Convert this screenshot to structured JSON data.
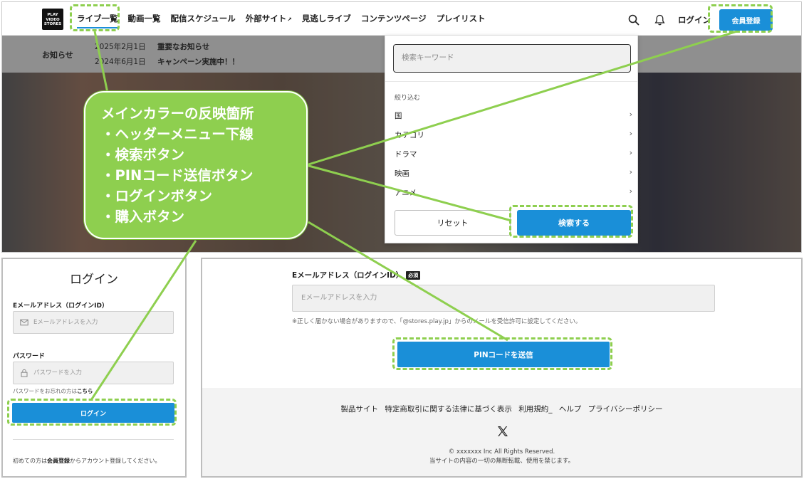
{
  "header": {
    "logo_text": "PLAY VIDEO STORES",
    "nav": [
      {
        "label": "ライブ一覧",
        "active": true
      },
      {
        "label": "動画一覧"
      },
      {
        "label": "配信スケジュール"
      },
      {
        "label": "外部サイト",
        "external": true
      },
      {
        "label": "見逃しライブ"
      },
      {
        "label": "コンテンツページ"
      },
      {
        "label": "プレイリスト"
      }
    ],
    "login_label": "ログイン",
    "register_label": "会員登録"
  },
  "notice": {
    "label": "お知らせ",
    "items": [
      {
        "date": "2025年2月1日",
        "text": "重要なお知らせ"
      },
      {
        "date": "2024年6月1日",
        "text": "キャンペーン実施中！！"
      }
    ]
  },
  "search_panel": {
    "placeholder": "検索キーワード",
    "filter_label": "絞り込む",
    "filters": [
      "国",
      "カテゴリ",
      "ドラマ",
      "映画",
      "アニメ"
    ],
    "reset_label": "リセット",
    "search_label": "検索する"
  },
  "callout": {
    "lines": [
      "メインカラーの反映箇所",
      "・ヘッダーメニュー下線",
      "・検索ボタン",
      "・PINコード送信ボタン",
      "・ログインボタン",
      "・購入ボタン"
    ]
  },
  "login_form": {
    "title": "ログイン",
    "email_label": "Eメールアドレス（ログインID）",
    "email_placeholder": "Eメールアドレスを入力",
    "password_label": "パスワード",
    "password_placeholder": "パスワードを入力",
    "forgot_prefix": "パスワードをお忘れの方は",
    "forgot_link": "こちら",
    "login_button": "ログイン",
    "first_time_prefix": "初めての方は",
    "first_time_link": "会員登録",
    "first_time_suffix": "からアカウント登録してください。"
  },
  "email_form": {
    "label": "Eメールアドレス（ログインID）",
    "required_badge": "必須",
    "placeholder": "Eメールアドレスを入力",
    "note": "※正しく届かない場合がありますので、「@stores.play.jp」からのメールを受信許可に設定してください。",
    "pin_button": "PINコードを送信"
  },
  "footer": {
    "links": [
      "製品サイト",
      "特定商取引に関する法律に基づく表示",
      "利用規約_",
      "ヘルプ",
      "プライバシーポリシー"
    ],
    "copyright": "© xxxxxxx Inc All Rights Reserved.",
    "notice": "当サイトの内容の一切の無断転載、使用を禁じます。"
  },
  "colors": {
    "accent": "#1a8fd8",
    "highlight_green": "#8ecf4f"
  }
}
